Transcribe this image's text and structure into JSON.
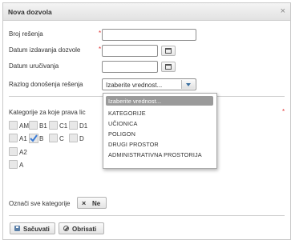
{
  "dialog": {
    "title": "Nova dozvola",
    "close_icon": "close-icon",
    "close_glyph": "×"
  },
  "form": {
    "broj_resenja_label": "Broj rešenja",
    "datum_izdavanja_label": "Datum izdavanja dozvole",
    "datum_urucivanja_label": "Datum uručivanja",
    "razlog_label": "Razlog donošenja rešenja",
    "required_mark": "*",
    "razlog_select_value": "Izaberite vrednost..."
  },
  "dropdown": {
    "options": [
      "Izaberite vrednost...",
      "KATEGORIJE",
      "UČIONICA",
      "POLIGON",
      "DRUGI PROSTOR",
      "ADMINISTRATIVNA PROSTORIJA"
    ],
    "selected_index": 0
  },
  "categories": {
    "label": "Kategorije za koje prava lic",
    "required_mark": "*",
    "items": [
      {
        "label": "AM",
        "checked": false
      },
      {
        "label": "B1",
        "checked": false
      },
      {
        "label": "C1",
        "checked": false
      },
      {
        "label": "D1",
        "checked": false
      },
      {
        "label": "A1",
        "checked": false
      },
      {
        "label": "B",
        "checked": true
      },
      {
        "label": "C",
        "checked": false
      },
      {
        "label": "D",
        "checked": false
      },
      {
        "label": "A2",
        "checked": false
      },
      {
        "label": "A",
        "checked": false
      }
    ]
  },
  "select_all": {
    "label": "Označi sve kategorije",
    "button_label": "Ne"
  },
  "actions": {
    "save_label": "Sačuvati",
    "delete_label": "Obrisati"
  },
  "colors": {
    "required": "#e03030",
    "checkbox_checked": "#3a7bd5",
    "dropdown_selected": "#9a9a9a"
  }
}
